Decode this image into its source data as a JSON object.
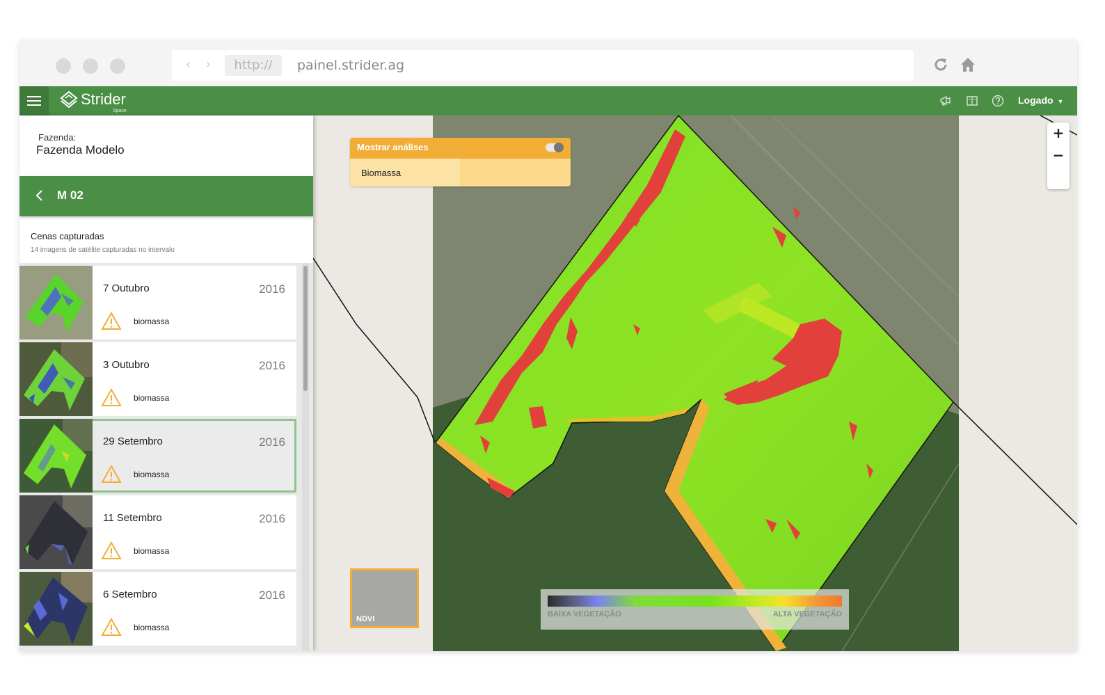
{
  "browser": {
    "scheme": "http://",
    "host": "painel.strider.ag"
  },
  "appbar": {
    "logo": "Strider",
    "logo_sub": "Space",
    "user": "Logado",
    "user_caret": "▼"
  },
  "sidebar": {
    "farm_label": "Fazenda:",
    "farm_name": "Fazenda Modelo",
    "field_name": "M 02",
    "scenes_title": "Cenas capturadas",
    "scenes_sub": "14 imagens de satélite capturadas no intervalo",
    "scenes": [
      {
        "date": "7 Outubro",
        "year": "2016",
        "tag": "biomassa",
        "selected": false
      },
      {
        "date": "3 Outubro",
        "year": "2016",
        "tag": "biomassa",
        "selected": false
      },
      {
        "date": "29 Setembro",
        "year": "2016",
        "tag": "biomassa",
        "selected": true
      },
      {
        "date": "11 Setembro",
        "year": "2016",
        "tag": "biomassa",
        "selected": false
      },
      {
        "date": "6 Setembro",
        "year": "2016",
        "tag": "biomassa",
        "selected": false
      }
    ]
  },
  "map": {
    "panel_title": "Mostrar análises",
    "panel_item": "Biomassa",
    "zoom_in": "+",
    "zoom_out": "−",
    "layer": "NDVI",
    "legend_low": "BAIXA VEGETAÇÃO",
    "legend_high": "ALTA VEGETAÇÃO"
  },
  "colors": {
    "brand_green": "#4a8f45",
    "accent_orange": "#f2ad37",
    "alert_red": "#e2403a",
    "vegetation_green": "#79dc1e"
  }
}
